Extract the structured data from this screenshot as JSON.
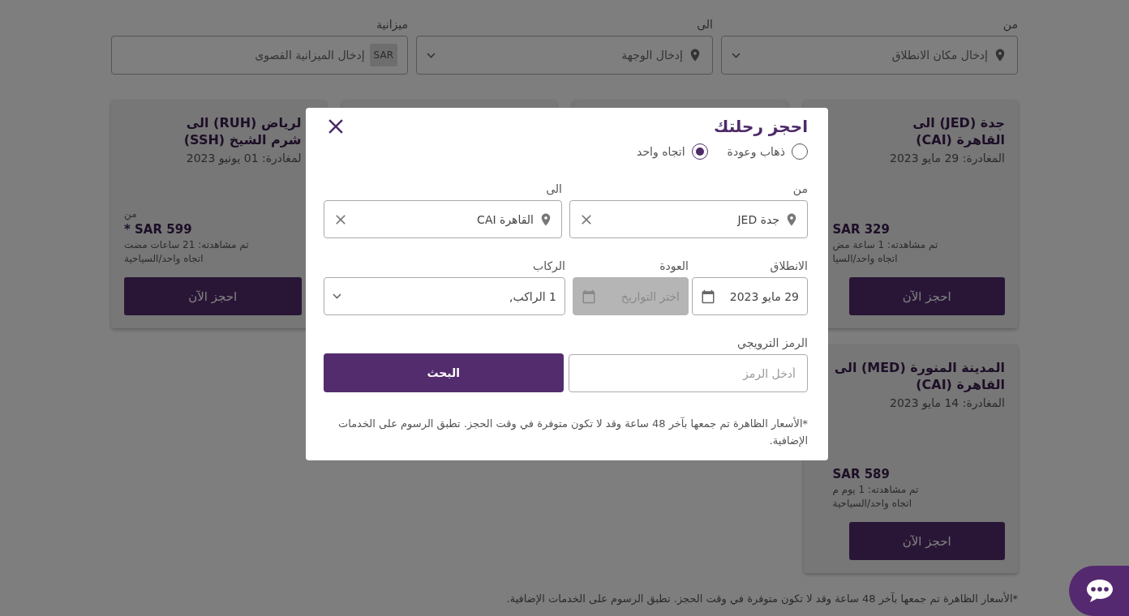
{
  "filters": [
    {
      "kind": "location",
      "label": "من",
      "placeholder": "إدخال مكان الانطلاق"
    },
    {
      "kind": "location",
      "label": "الى",
      "placeholder": "إدخال الوجهة"
    },
    {
      "kind": "budget",
      "label": "ميزانية",
      "currency": "SAR",
      "placeholder": "إدخال الميزانية القصوى"
    }
  ],
  "cards": [
    {
      "kind": "offer",
      "title_lines": [
        "جدة (JED) الى",
        "القاهرة (CAI)"
      ],
      "departure": "المغادرة: 29 مايو 2023",
      "price": "SAR 329",
      "viewed": "تم مشاهدته: 1 ساعة مض",
      "trip_type": "اتجاه واحد/السيا",
      "button": "احجز الآن"
    },
    {
      "kind": "covered"
    },
    {
      "kind": "covered"
    },
    {
      "kind": "offer",
      "title_lines": [
        "لرياض (RUH) الى",
        "شرم الشيخ (SSH)"
      ],
      "departure": "لمغادرة: 01 يونيو 2023",
      "from_label": "من",
      "price": "* SAR 599",
      "viewed": "تم مشاهدته: 21 ساعات مضت",
      "trip_type": "اتجاه واحد/السياحية",
      "button": "احجز الآن"
    },
    {
      "kind": "offer",
      "title_lines": [
        "المدينة المنورة (MED) الى",
        "القاهرة (CAI)"
      ],
      "departure": "المغادرة: 14 مايو 2023",
      "price": "SAR 589",
      "viewed": "تم مشاهدته: 1 يوم م",
      "trip_type": "اتجاه واحد/السياحية",
      "button": "احجز الآن"
    }
  ],
  "page_note": "*الأسعار الظاهرة تم جمعها بآخر 48 ساعة وقد لا تكون متوفرة في وقت الحجز. تطبق الرسوم على الخدمات الإضافية.",
  "modal": {
    "title": "احجز رحلتك",
    "trip_types": [
      {
        "label": "ذهاب وعودة",
        "selected": false
      },
      {
        "label": "اتجاه واحد",
        "selected": true
      }
    ],
    "from": {
      "label": "من",
      "value": "جدة JED"
    },
    "to": {
      "label": "الى",
      "value": "القاهرة CAI"
    },
    "departure": {
      "label": "الانطلاق",
      "value": "29 مايو 2023"
    },
    "return": {
      "label": "العودة",
      "placeholder": "اختر التواريخ",
      "disabled": true
    },
    "passengers": {
      "label": "الركاب",
      "value": "1 الراكب,"
    },
    "promo": {
      "label": "الرمز الترويجي",
      "placeholder": "أدخل الرمز"
    },
    "search_button": "البحث",
    "note": "*الأسعار الظاهرة تم جمعها بآخر 48 ساعة وقد لا تكون متوفرة في وقت الحجز. تطبق الرسوم على الخدمات الإضافية."
  }
}
